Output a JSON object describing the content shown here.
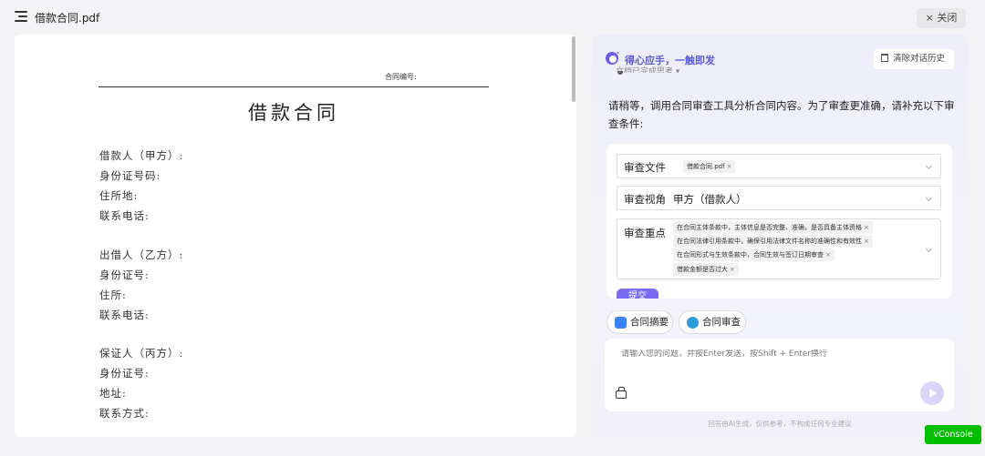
{
  "header": {
    "file_title": "借款合同.pdf",
    "close_label": "× 关闭"
  },
  "document": {
    "contract_no_label": "合同编号:",
    "title": "借款合同",
    "lines": [
      "借款人（甲方）:",
      "身份证号码:",
      "住所地:",
      "联系电话:",
      "出借人（乙方）:",
      "身份证号:",
      "住所:",
      "联系电话:",
      "保证人（丙方）:",
      "身份证号:",
      "地址:",
      "联系方式:"
    ]
  },
  "assistant": {
    "brand": "得心应手，一触即发",
    "clear_history": "清除对话历史",
    "peek_text": "文档已完成思考 ▾",
    "prompt": "请稍等，调用合同审查工具分析合同内容。为了审查更准确，请补充以下审查条件:",
    "form": {
      "file_label": "审查文件",
      "file_tag": "借款合同.pdf",
      "view_label": "审查视角",
      "view_value": "甲方（借款人）",
      "focus_label": "审查重点",
      "focus_tags": [
        "在合同主体条款中，主体信息是否完整、准确，是否具备主体资格",
        "在合同法律引用条款中，确保引用法律文件名称的准确性和有效性",
        "在合同形式与生效条款中，合同生效与签订日期审查",
        "借款金额是否过大"
      ],
      "submit_label": "提交"
    },
    "actions": {
      "summary": "合同摘要",
      "review": "合同审查"
    },
    "input_placeholder": "请输入您的问题，并按Enter发送，按Shift + Enter换行",
    "disclaimer": "回答由AI生成，仅供参考，不构成任何专业建议"
  },
  "vconsole_label": "vConsole",
  "colors": {
    "brand": "#5b5bd6",
    "accent": "#7a6cf0",
    "vconsole": "#04be02"
  }
}
